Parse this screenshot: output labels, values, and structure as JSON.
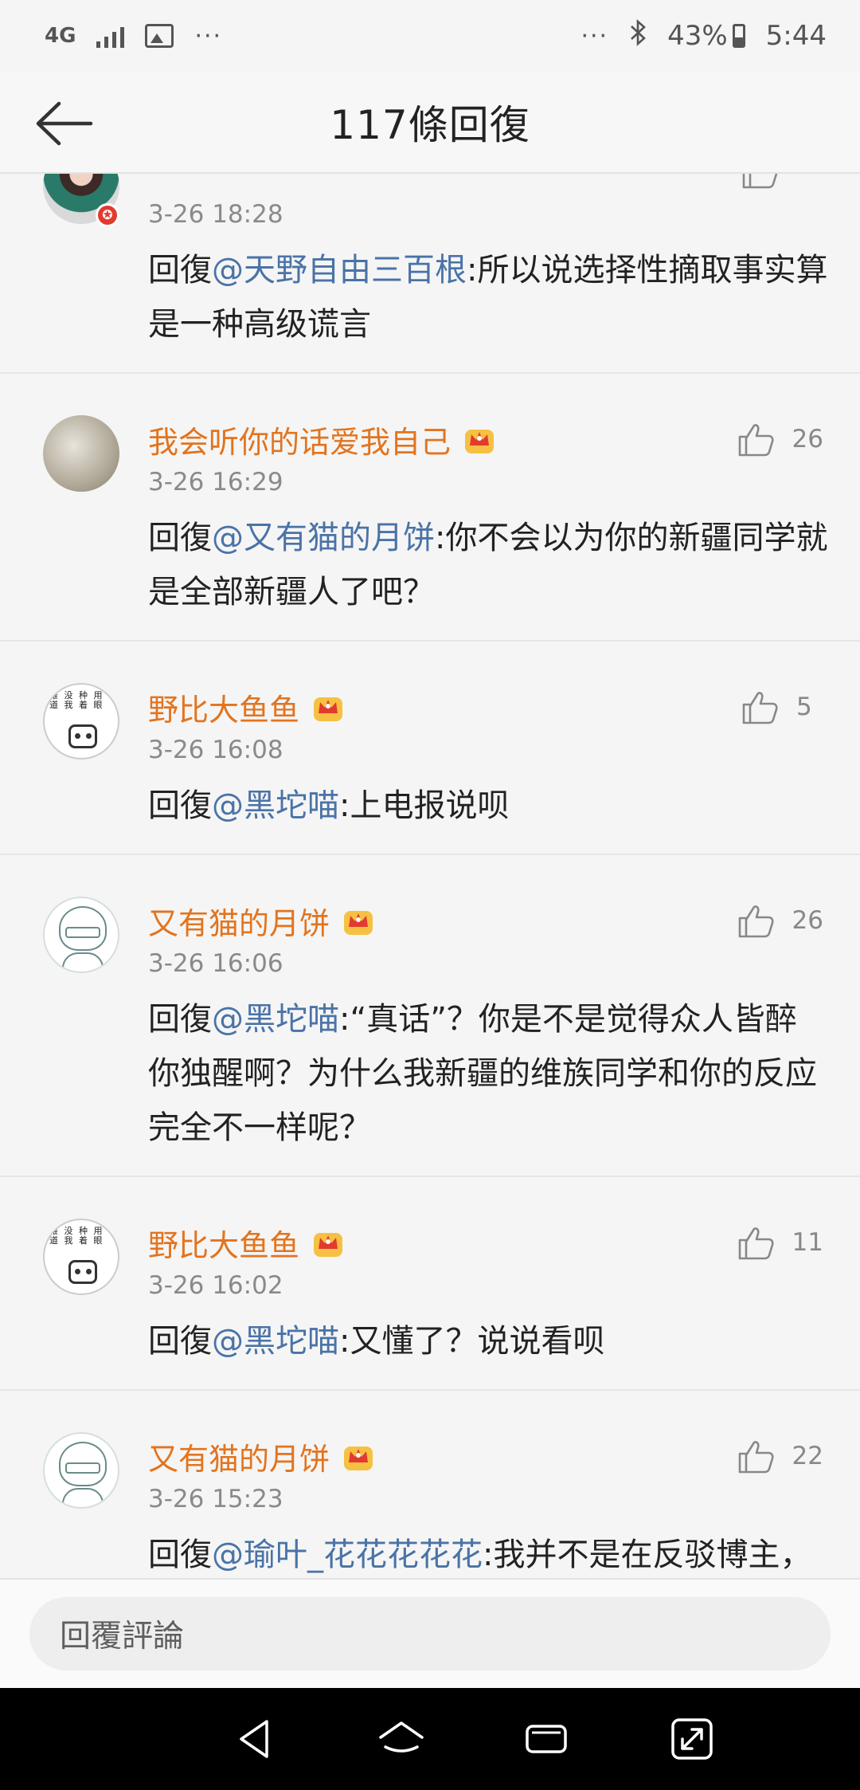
{
  "status_bar": {
    "network": "4G",
    "overflow": "···",
    "overflow_right": "···",
    "bluetooth_icon": "bluetooth-icon",
    "battery_percent": "43%",
    "time": "5:44"
  },
  "header": {
    "title": "117條回復",
    "back_icon": "back-arrow-icon"
  },
  "comments": [
    {
      "username": "",
      "time": "3-26 18:28",
      "likes": "",
      "reply_prefix": "回復",
      "mention": "@天野自由三百根",
      "text": ":所以说选择性摘取事实算是一种高级谎言"
    },
    {
      "username": "我会听你的话爱我自己",
      "time": "3-26 16:29",
      "likes": "26",
      "reply_prefix": "回復",
      "mention": "@又有猫的月饼",
      "text": ":你不会以为你的新疆同学就是全部新疆人了吧？"
    },
    {
      "username": "野比大鱼鱼",
      "time": "3-26 16:08",
      "likes": "5",
      "reply_prefix": "回復",
      "mention": "@黑坨喵",
      "text": ":上电报说呗"
    },
    {
      "username": "又有猫的月饼",
      "time": "3-26 16:06",
      "likes": "26",
      "reply_prefix": "回復",
      "mention": "@黑坨喵",
      "text": ":“真话”？你是不是觉得众人皆醉你独醒啊？为什么我新疆的维族同学和你的反应完全不一样呢？"
    },
    {
      "username": "野比大鱼鱼",
      "time": "3-26 16:02",
      "likes": "11",
      "reply_prefix": "回復",
      "mention": "@黑坨喵",
      "text": ":又懂了？说说看呗"
    },
    {
      "username": "又有猫的月饼",
      "time": "3-26 15:23",
      "likes": "22",
      "reply_prefix": "回復",
      "mention": "@瑜叶_花花花花花",
      "text": ":我并不是在反驳博主，我说的对象是评论区里的某些人，请您做好阅读理解。"
    }
  ],
  "reply_bar": {
    "placeholder": "回覆評論"
  },
  "nav_bar": {
    "icons": [
      "back-triangle-icon",
      "home-icon",
      "recents-icon",
      "rotate-icon"
    ]
  },
  "colors": {
    "username": "#e2741f",
    "mention": "#4a73a6",
    "background": "#f5f5f5"
  }
}
